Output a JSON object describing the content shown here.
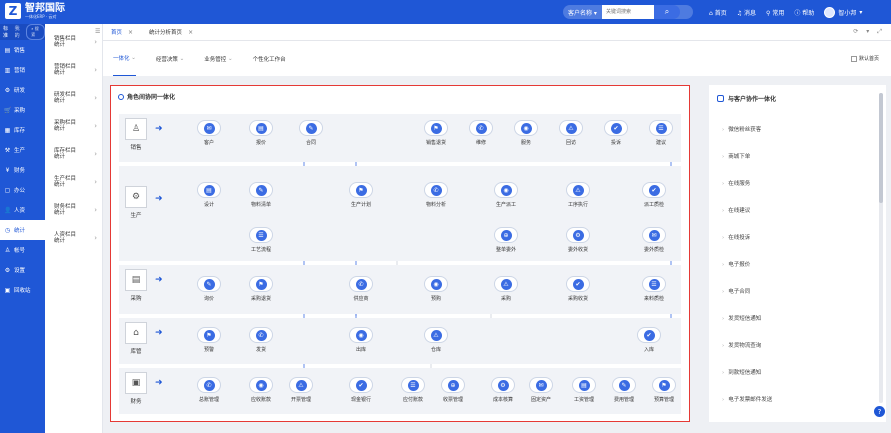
{
  "brand": {
    "mark": "Z",
    "name": "智邦国际",
    "sub": "一体化ERP · 云对"
  },
  "topbar": {
    "search_scope": "客户名称",
    "search_placeholder": "关键词搜索",
    "links": {
      "home": "首页",
      "messages": "消息",
      "common": "常用",
      "help": "帮助",
      "user": "智小邦"
    }
  },
  "sidebar": {
    "tabs": [
      "标准",
      "我的"
    ],
    "search": "搜索",
    "items": [
      {
        "icon": "▤",
        "label": "销售"
      },
      {
        "icon": "▥",
        "label": "营销"
      },
      {
        "icon": "⚙",
        "label": "研发"
      },
      {
        "icon": "🛒",
        "label": "采购"
      },
      {
        "icon": "▦",
        "label": "库存"
      },
      {
        "icon": "⚒",
        "label": "生产"
      },
      {
        "icon": "¥",
        "label": "财务"
      },
      {
        "icon": "▢",
        "label": "办公"
      },
      {
        "icon": "👤",
        "label": "人资"
      },
      {
        "icon": "◷",
        "label": "统计"
      },
      {
        "icon": "♙",
        "label": "帐号"
      },
      {
        "icon": "⚙",
        "label": "设置"
      },
      {
        "icon": "▣",
        "label": "回收站"
      }
    ]
  },
  "subnav": [
    {
      "line1": "销售栏目",
      "line2": "统计"
    },
    {
      "line1": "营销栏目",
      "line2": "统计"
    },
    {
      "line1": "研发栏目",
      "line2": "统计"
    },
    {
      "line1": "采购栏目",
      "line2": "统计"
    },
    {
      "line1": "库存栏目",
      "line2": "统计"
    },
    {
      "line1": "生产栏目",
      "line2": "统计"
    },
    {
      "line1": "财务栏目",
      "line2": "统计"
    },
    {
      "line1": "人资栏目",
      "line2": "统计"
    }
  ],
  "tabs": [
    {
      "label": "首页"
    },
    {
      "label": "统计分析首页"
    }
  ],
  "subtabs": [
    "一体化",
    "经营决策",
    "业务管控",
    "个性化工作台"
  ],
  "default_home": "默认首页",
  "main": {
    "title": "角色间协同一体化",
    "roles": [
      "销售",
      "生产",
      "采购",
      "库管",
      "财务"
    ],
    "sales_nodes": [
      "客户",
      "报价",
      "合同",
      "销售退货",
      "维修",
      "服务",
      "回访",
      "投诉",
      "建议"
    ],
    "prod_nodes": [
      "设计",
      "物料清单",
      "生产计划",
      "物料分析",
      "生产派工",
      "工序执行",
      "派工质检",
      "工艺流程",
      "整单委外",
      "委外收货",
      "委外质检"
    ],
    "purchase_nodes": [
      "询价",
      "采购退货",
      "供应商",
      "预购",
      "采购",
      "采购收货",
      "来料质检"
    ],
    "stock_nodes": [
      "预警",
      "发货",
      "出库",
      "仓库",
      "入库"
    ],
    "finance_nodes": [
      "总账管理",
      "应收账款",
      "开票管理",
      "现金银行",
      "应付账款",
      "收票管理",
      "成本核算",
      "固定资产",
      "工资管理",
      "费用管理",
      "预算管理"
    ]
  },
  "right_panel": {
    "title": "与客户协作一体化",
    "items": [
      "微信粉丝获客",
      "商城下单",
      "在线服务",
      "在线建议",
      "在线投诉",
      "电子报价",
      "电子合同",
      "发货短信通知",
      "发货物流查询",
      "到款短信通知",
      "电子发票邮件发送"
    ]
  },
  "colors": {
    "brand": "#1f57d6",
    "highlight_border": "#e53935"
  }
}
